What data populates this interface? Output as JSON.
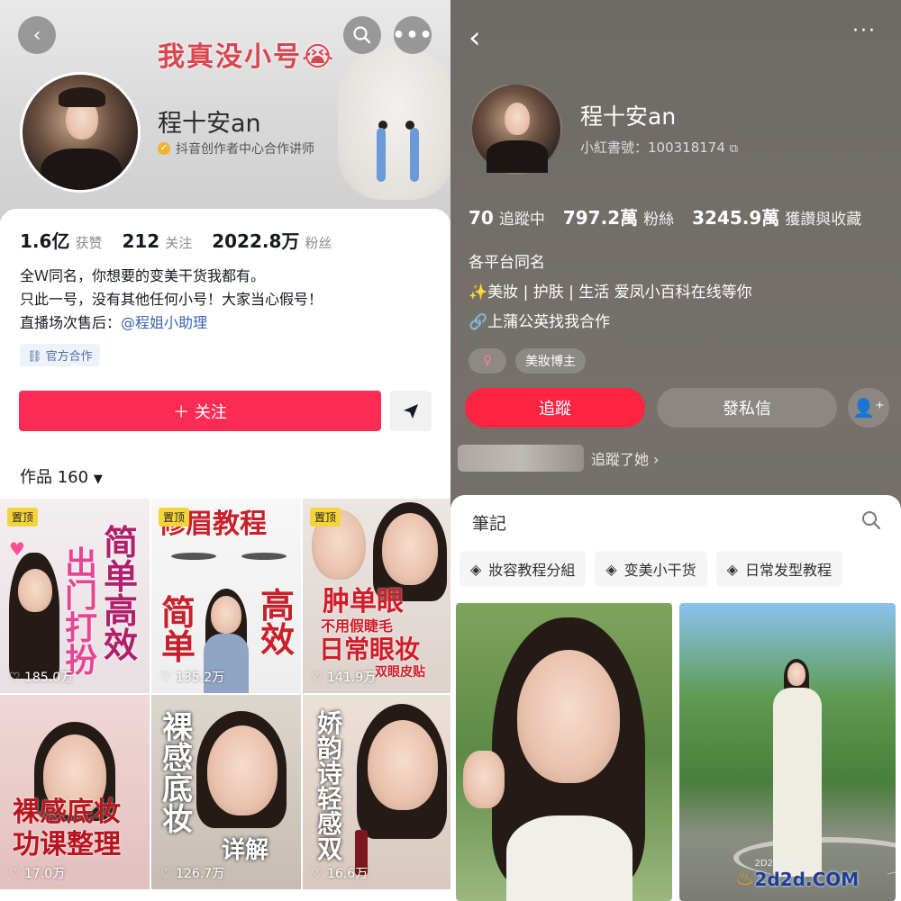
{
  "left": {
    "banner_title": "我真没小号😭",
    "profile": {
      "name": "程十安an",
      "verification": "抖音创作者中心合作讲师"
    },
    "stats": [
      {
        "num": "1.6亿",
        "label": "获赞"
      },
      {
        "num": "212",
        "label": "关注"
      },
      {
        "num": "2022.8万",
        "label": "粉丝"
      }
    ],
    "bio": {
      "line1": "全Ｗ同名，你想要的变美干货我都有。",
      "line2": "只此一号，没有其他任何小号！大家当心假号！",
      "line3_prefix": "直播场次售后：",
      "line3_mention": "@程姐小助理"
    },
    "tag": "官方合作",
    "follow_label": "＋ 关注",
    "works_label": "作品 160",
    "pinned_label": "置顶",
    "tiles": [
      {
        "caption_a": "简单高效",
        "caption_b": "出门打扮",
        "likes": "185.0万",
        "pinned": true
      },
      {
        "caption_a": "修眉教程",
        "caption_b": "简 单",
        "caption_c": "高 效",
        "likes": "135.2万",
        "pinned": true
      },
      {
        "caption_a": "肿单眼",
        "caption_b": "不用假睫毛",
        "caption_c": "日常眼妆",
        "caption_d": "双眼皮贴",
        "likes": "141.9万",
        "pinned": true
      },
      {
        "caption_a": "裸感底妆",
        "caption_b": "功课整理",
        "likes": "17.0万"
      },
      {
        "caption_a": "裸感底妆",
        "caption_b": "详解",
        "likes": "126.7万"
      },
      {
        "caption_a": "娇韵诗轻感双",
        "likes": "16.6万"
      }
    ]
  },
  "right": {
    "profile": {
      "name": "程十安an",
      "red_id": "小紅書號：100318174"
    },
    "stats": [
      {
        "num": "70",
        "label": "追蹤中"
      },
      {
        "num": "797.2萬",
        "label": "粉絲"
      },
      {
        "num": "3245.9萬",
        "label": "獲讚與收藏"
      }
    ],
    "bio": {
      "line1": "各平台同名",
      "line2": "✨美妝 | 护肤 | 生活 爱凤小百科在线等你",
      "line3": "🔗上蒲公英找我合作"
    },
    "gender_symbol": "♀",
    "tag": "美妝博主",
    "follow_label": "追蹤",
    "message_label": "發私信",
    "followed_text": "追蹤了她 ›",
    "notes_title": "筆記",
    "albums": [
      "妝容教程分組",
      "变美小干货",
      "日常发型教程"
    ]
  },
  "watermark": {
    "text": "2d2d.COM",
    "subtext": "2D2D手游网"
  }
}
